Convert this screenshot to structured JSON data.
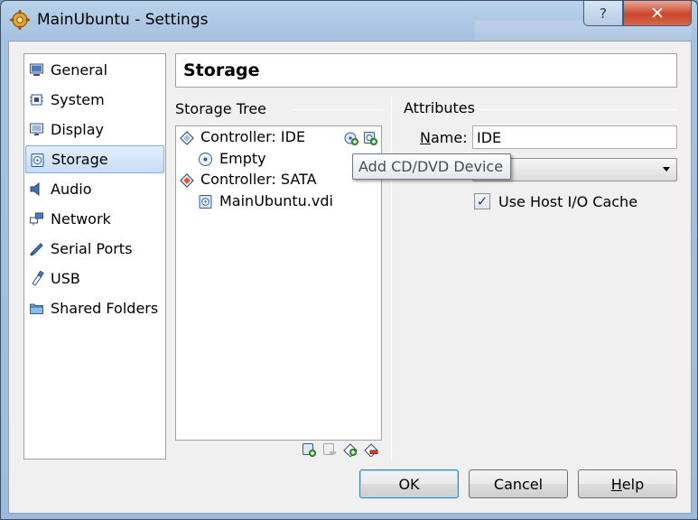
{
  "window": {
    "title": "MainUbuntu - Settings",
    "help_glyph": "?",
    "close_glyph": "✕"
  },
  "nav": {
    "items": [
      {
        "label": "General",
        "icon": "general-icon"
      },
      {
        "label": "System",
        "icon": "system-chip-icon"
      },
      {
        "label": "Display",
        "icon": "display-monitor-icon"
      },
      {
        "label": "Storage",
        "icon": "storage-disk-icon",
        "selected": true
      },
      {
        "label": "Audio",
        "icon": "audio-speaker-icon"
      },
      {
        "label": "Network",
        "icon": "network-icon"
      },
      {
        "label": "Serial Ports",
        "icon": "serial-port-icon"
      },
      {
        "label": "USB",
        "icon": "usb-icon"
      },
      {
        "label": "Shared Folders",
        "icon": "folder-icon"
      }
    ]
  },
  "page": {
    "title": "Storage",
    "storage_tree_label": "Storage Tree",
    "attributes_label": "Attributes"
  },
  "tree": {
    "controller_ide": "Controller: IDE",
    "empty": "Empty",
    "controller_sata": "Controller: SATA",
    "disk": "MainUbuntu.vdi"
  },
  "tooltip": "Add CD/DVD Device",
  "attributes": {
    "name_label_prefix": "N",
    "name_label_rest": "ame:",
    "name_value": "IDE",
    "combo_value": "",
    "checkbox_checked": true,
    "checkbox_label": "Use Host I/O Cache"
  },
  "buttons": {
    "ok": "OK",
    "cancel": "Cancel",
    "help_first": "H",
    "help_rest": "elp"
  },
  "colors": {
    "selection": "#c8dcf5",
    "accent": "#3c7fb1"
  }
}
